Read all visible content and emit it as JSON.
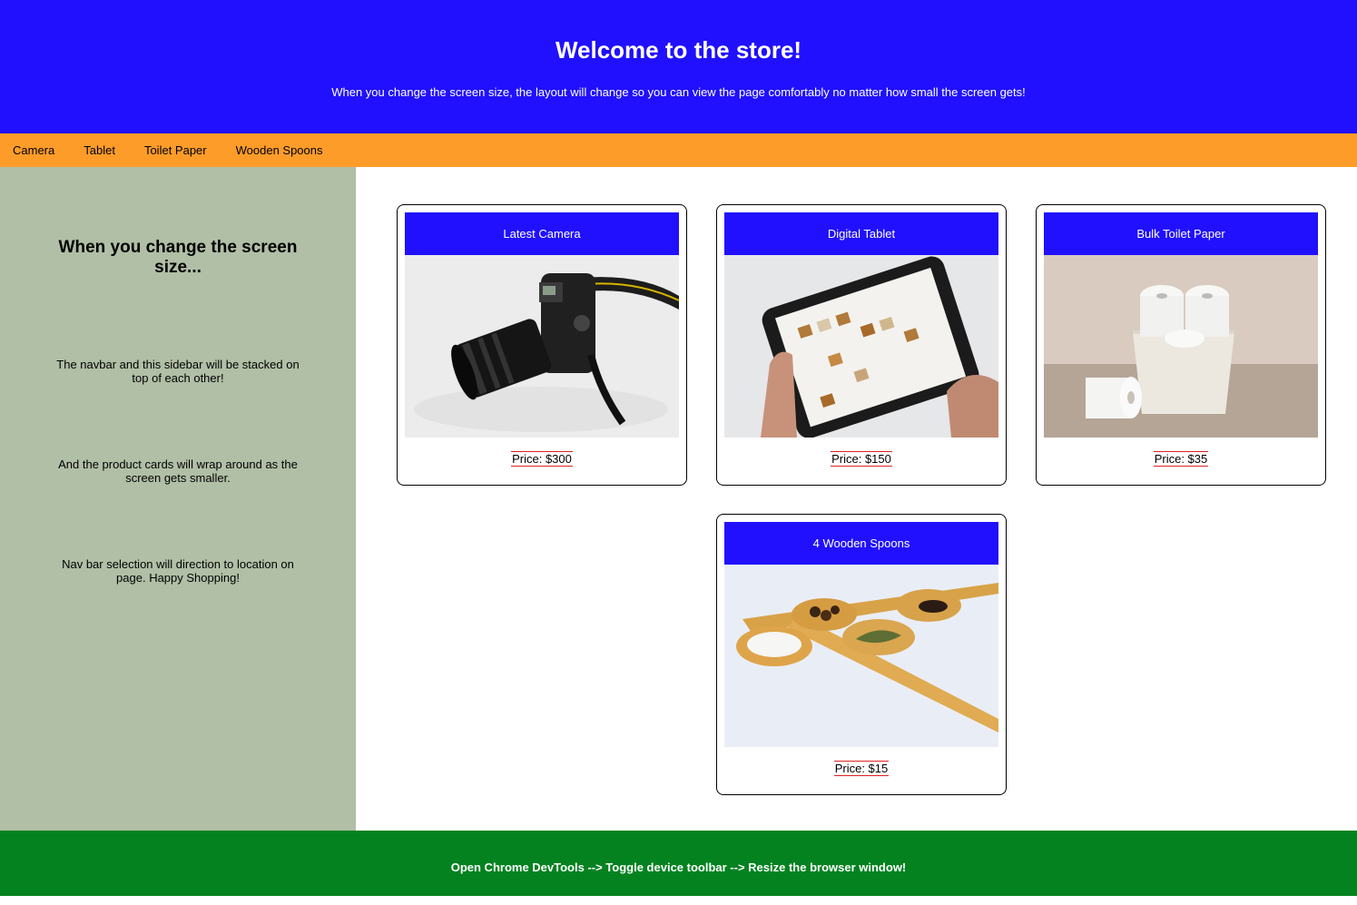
{
  "header": {
    "title": "Welcome to the store!",
    "subtitle": "When you change the screen size, the layout will change so you can view the page comfortably no matter how small the screen gets!"
  },
  "nav": {
    "items": [
      "Camera",
      "Tablet",
      "Toilet Paper",
      "Wooden Spoons"
    ]
  },
  "sidebar": {
    "heading": "When you change the screen size...",
    "paragraphs": [
      "The navbar and this sidebar will be stacked on top of each other!",
      "And the product cards will wrap around as the screen gets smaller.",
      "Nav bar selection will direction to location on page. Happy Shopping!"
    ]
  },
  "products": [
    {
      "title": "Latest Camera",
      "price": "Price: $300",
      "image": "camera-photo"
    },
    {
      "title": "Digital Tablet",
      "price": "Price: $150",
      "image": "tablet-photo"
    },
    {
      "title": "Bulk Toilet Paper",
      "price": "Price: $35",
      "image": "toilet-paper-photo"
    },
    {
      "title": "4 Wooden Spoons",
      "price": "Price: $15",
      "image": "wooden-spoons-photo"
    }
  ],
  "footer": {
    "text": "Open Chrome DevTools --> Toggle device toolbar --> Resize the browser window!"
  },
  "colors": {
    "header_bg": "#2010fd",
    "nav_bg": "#fe9c29",
    "sidebar_bg": "#b0bfa6",
    "footer_bg": "#048220",
    "card_title_bg": "#2010fd"
  }
}
